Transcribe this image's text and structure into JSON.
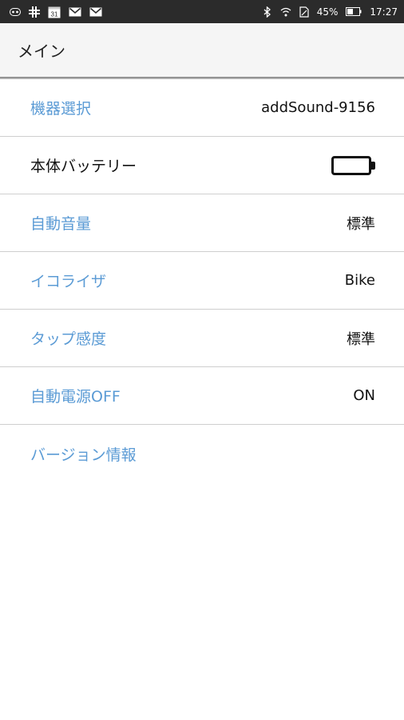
{
  "status_bar": {
    "left_icons": [
      "voicemail-icon",
      "slack-icon",
      "calendar-icon",
      "gmail-icon",
      "gmail-icon"
    ],
    "calendar_date": "31",
    "battery_percent": "45%",
    "time": "17:27"
  },
  "app_bar": {
    "title": "メイン"
  },
  "settings": [
    {
      "label": "機器選択",
      "value": "addSound-9156",
      "label_color": "#5b9bd5"
    },
    {
      "label": "本体バッテリー",
      "value_icon": "battery-full-icon",
      "label_color": "#111111"
    },
    {
      "label": "自動音量",
      "value": "標準",
      "label_color": "#5b9bd5"
    },
    {
      "label": "イコライザ",
      "value": "Bike",
      "label_color": "#5b9bd5"
    },
    {
      "label": "タップ感度",
      "value": "標準",
      "label_color": "#5b9bd5"
    },
    {
      "label": "自動電源OFF",
      "value": "ON",
      "label_color": "#5b9bd5"
    },
    {
      "label": "バージョン情報",
      "label_color": "#5b9bd5"
    }
  ],
  "colors": {
    "accent": "#5b9bd5",
    "status_bar": "#2b2b2b",
    "app_bar": "#f5f5f5"
  }
}
